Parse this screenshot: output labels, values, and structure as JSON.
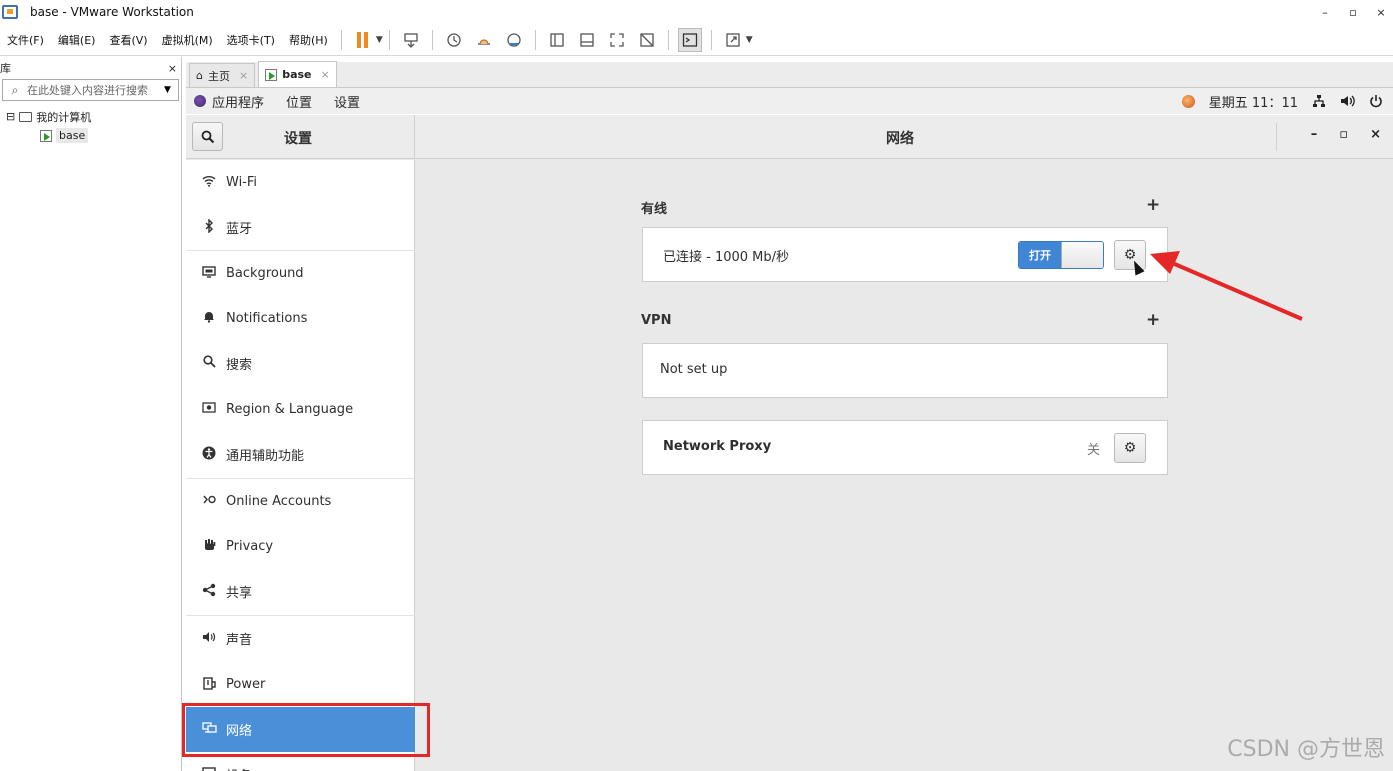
{
  "window": {
    "title": "base - VMware Workstation",
    "controls": [
      "–",
      "▫",
      "×"
    ]
  },
  "menubar": {
    "items": [
      "文件(F)",
      "编辑(E)",
      "查看(V)",
      "虚拟机(M)",
      "选项卡(T)",
      "帮助(H)"
    ]
  },
  "library": {
    "title": "库",
    "close": "×",
    "search_placeholder": "在此处键入内容进行搜索",
    "tree": {
      "root": "我的计算机",
      "child": "base",
      "expander": "⊟"
    }
  },
  "vm_tabs": [
    {
      "label": "主页",
      "close": "×"
    },
    {
      "label": "base",
      "close": "×"
    }
  ],
  "gnome_bar": {
    "menus": [
      "应用程序",
      "位置",
      "设置"
    ],
    "clock": "星期五 11：11"
  },
  "settings": {
    "sidebar_title": "设置",
    "page_title": "网络",
    "window_controls": [
      "–",
      "▫",
      "×"
    ],
    "sidebar_items": [
      {
        "label": "Wi-Fi",
        "icon": "wifi-icon"
      },
      {
        "label": "蓝牙",
        "icon": "bluetooth-icon"
      },
      {
        "label": "Background",
        "icon": "background-icon"
      },
      {
        "label": "Notifications",
        "icon": "bell-icon"
      },
      {
        "label": "搜索",
        "icon": "search-icon"
      },
      {
        "label": "Region & Language",
        "icon": "region-icon"
      },
      {
        "label": "通用辅助功能",
        "icon": "accessibility-icon"
      },
      {
        "label": "Online Accounts",
        "icon": "online-accounts-icon"
      },
      {
        "label": "Privacy",
        "icon": "hand-icon"
      },
      {
        "label": "共享",
        "icon": "share-icon"
      },
      {
        "label": "声音",
        "icon": "speaker-icon"
      },
      {
        "label": "Power",
        "icon": "power-icon"
      },
      {
        "label": "网络",
        "icon": "network-icon",
        "selected": true
      },
      {
        "label": "设备",
        "icon": "devices-icon"
      }
    ],
    "wired": {
      "title": "有线",
      "add": "+",
      "status": "已连接 - 1000 Mb/秒",
      "switch_label": "打开"
    },
    "vpn": {
      "title": "VPN",
      "add": "+",
      "status": "Not set up"
    },
    "proxy": {
      "label": "Network Proxy",
      "status": "关"
    }
  },
  "watermark": "CSDN @方世恩",
  "colors": {
    "accent": "#4a90d9",
    "annotation": "#e52727",
    "pause": "#f08a1c"
  }
}
